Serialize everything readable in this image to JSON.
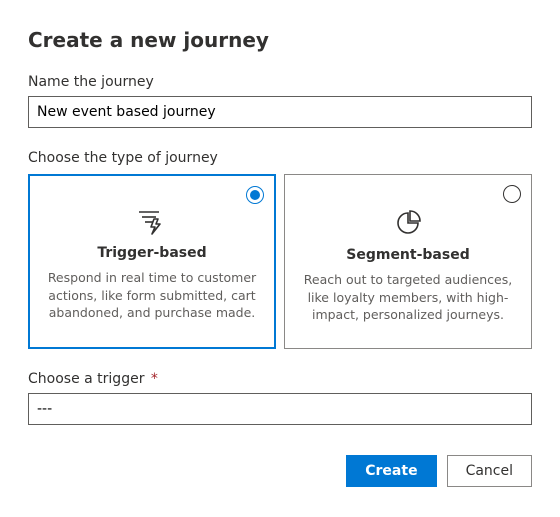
{
  "title": "Create a new journey",
  "name_field": {
    "label": "Name the journey",
    "value": "New event based journey"
  },
  "type_section": {
    "label": "Choose the type of journey",
    "selected": "trigger",
    "options": {
      "trigger": {
        "title": "Trigger-based",
        "description": "Respond in real time to customer actions, like form submitted, cart abandoned, and purchase made."
      },
      "segment": {
        "title": "Segment-based",
        "description": "Reach out to targeted audiences, like loyalty members, with high-impact, personalized journeys."
      }
    }
  },
  "trigger_field": {
    "label": "Choose a trigger",
    "required_mark": "*",
    "value": "---"
  },
  "actions": {
    "create": "Create",
    "cancel": "Cancel"
  }
}
